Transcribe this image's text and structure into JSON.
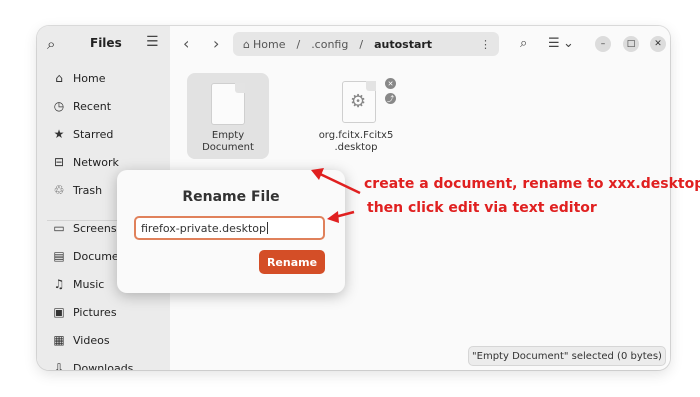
{
  "sidebar": {
    "title": "Files",
    "search_icon": "search-icon",
    "menu_icon": "hamburger-menu-icon",
    "items": [
      {
        "label": "Home",
        "icon": "home-icon",
        "glyph": "⌂"
      },
      {
        "label": "Recent",
        "icon": "clock-icon",
        "glyph": "◷"
      },
      {
        "label": "Starred",
        "icon": "star-icon",
        "glyph": "★"
      },
      {
        "label": "Network",
        "icon": "network-icon",
        "glyph": "⊟"
      },
      {
        "label": "Trash",
        "icon": "trash-icon",
        "glyph": "♲"
      },
      {
        "label": "Screenshots",
        "icon": "folder-icon",
        "glyph": "▭"
      },
      {
        "label": "Documents",
        "icon": "document-icon",
        "glyph": "▤"
      },
      {
        "label": "Music",
        "icon": "music-icon",
        "glyph": "♫"
      },
      {
        "label": "Pictures",
        "icon": "picture-icon",
        "glyph": "▣"
      },
      {
        "label": "Videos",
        "icon": "video-icon",
        "glyph": "▦"
      },
      {
        "label": "Downloads",
        "icon": "download-icon",
        "glyph": "⇩"
      }
    ]
  },
  "header": {
    "back": "‹",
    "forward": "›",
    "breadcrumb": {
      "home_glyph": "⌂",
      "home": "Home",
      "sep1": "/",
      "config": ".config",
      "sep2": "/",
      "current": "autostart",
      "more": "⋮"
    },
    "search_glyph": "⌕",
    "view_glyph": "☰",
    "view_arrow": "⌄",
    "minimize": "–",
    "maximize": "□",
    "close": "✕"
  },
  "files": [
    {
      "name_line1": "Empty",
      "name_line2": "Document",
      "selected": true
    },
    {
      "name_line1": "org.fcitx.Fcitx5",
      "name_line2": ".desktop",
      "selected": false,
      "emblems": [
        "✕",
        "⤴"
      ],
      "icon": "gear-icon",
      "glyph": "⚙"
    }
  ],
  "status": "\"Empty Document\" selected  (0 bytes)",
  "dialog": {
    "title": "Rename File",
    "input_value": "firefox-private.desktop",
    "button": "Rename"
  },
  "annotations": {
    "line1": "create a document, rename to xxx.desktop",
    "line2": "then click edit via text editor",
    "color": "#e02020"
  }
}
